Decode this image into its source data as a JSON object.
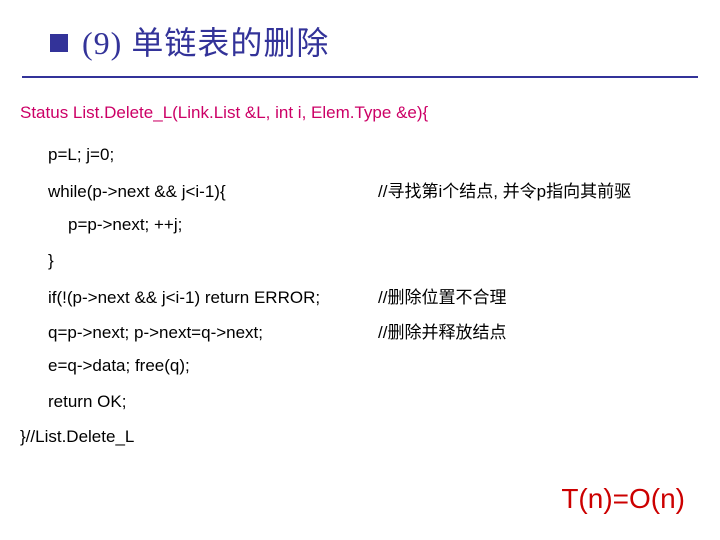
{
  "title": "(9) 单链表的删除",
  "signature": "Status List.Delete_L(Link.List &L, int i, Elem.Type &e){",
  "line_init": "p=L; j=0;",
  "while_code": "while(p->next && j<i-1){",
  "while_comment": "//寻找第i个结点, 并令p指向其前驱",
  "line_loop": "p=p->next; ++j;",
  "line_brace": "}",
  "if_code": "if(!(p->next && j<i-1) return ERROR;",
  "if_comment": "//删除位置不合理",
  "q_code": "q=p->next; p->next=q->next;",
  "q_comment": "//删除并释放结点",
  "line_e": "e=q->data; free(q);",
  "line_return": "return OK;",
  "line_close": "}//List.Delete_L",
  "complexity": "T(n)=O(n)"
}
